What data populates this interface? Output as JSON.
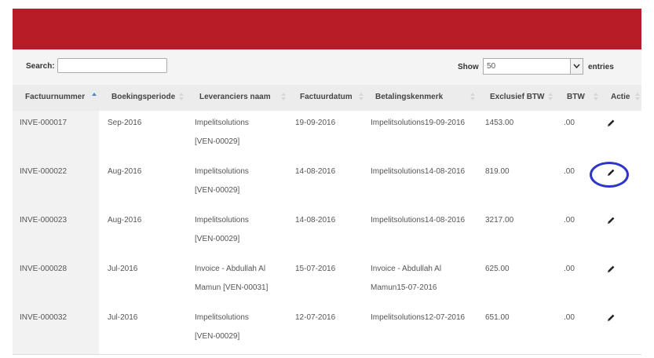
{
  "toolbar": {
    "search_label": "Search:",
    "search_value": "",
    "show_label": "Show",
    "page_length": "50",
    "entries_label": "entries"
  },
  "table": {
    "columns": [
      "Factuurnummer",
      "Boekingsperiode",
      "Leveranciers naam",
      "Factuurdatum",
      "Betalingskenmerk",
      "Exclusief BTW",
      "BTW",
      "Actie"
    ],
    "sorted_column": "Factuurnummer",
    "sort_direction": "ascending",
    "rows": [
      {
        "invoice": "INVE-000017",
        "period": "Sep-2016",
        "supplier_line1": "Impelitsolutions",
        "supplier_line2": "[VEN-00029]",
        "date": "19-09-2016",
        "reference_line1": "Impelitsolutions19-09-2016",
        "reference_line2": "",
        "excl_btw": "1453.00",
        "btw": ".00",
        "action_icon": "pencil-icon"
      },
      {
        "invoice": "INVE-000022",
        "period": "Aug-2016",
        "supplier_line1": "Impelitsolutions",
        "supplier_line2": "[VEN-00029]",
        "date": "14-08-2016",
        "reference_line1": "Impelitsolutions14-08-2016",
        "reference_line2": "",
        "excl_btw": "819.00",
        "btw": ".00",
        "action_icon": "pencil-icon"
      },
      {
        "invoice": "INVE-000023",
        "period": "Aug-2016",
        "supplier_line1": "Impelitsolutions",
        "supplier_line2": "[VEN-00029]",
        "date": "14-08-2016",
        "reference_line1": "Impelitsolutions14-08-2016",
        "reference_line2": "",
        "excl_btw": "3217.00",
        "btw": ".00",
        "action_icon": "pencil-icon"
      },
      {
        "invoice": "INVE-000028",
        "period": "Jul-2016",
        "supplier_line1": "Invoice - Abdullah Al",
        "supplier_line2": "Mamun [VEN-00031]",
        "date": "15-07-2016",
        "reference_line1": "Invoice - Abdullah Al",
        "reference_line2": "Mamun15-07-2016",
        "excl_btw": "625.00",
        "btw": ".00",
        "action_icon": "pencil-icon"
      },
      {
        "invoice": "INVE-000032",
        "period": "Jul-2016",
        "supplier_line1": "Impelitsolutions",
        "supplier_line2": "[VEN-00029]",
        "date": "12-07-2016",
        "reference_line1": "Impelitsolutions12-07-2016",
        "reference_line2": "",
        "excl_btw": "651.00",
        "btw": ".00",
        "action_icon": "pencil-icon"
      }
    ]
  },
  "annotation": {
    "highlight_color": "#2e35c9"
  },
  "theme": {
    "banner_color": "#b71c27"
  }
}
